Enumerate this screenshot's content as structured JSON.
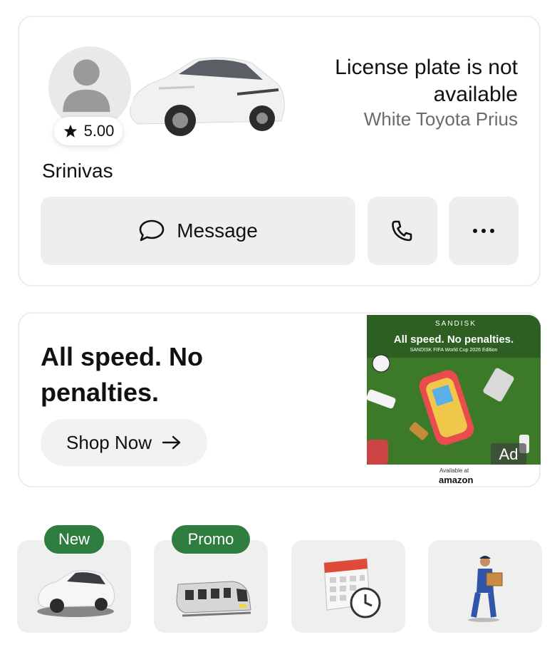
{
  "driver": {
    "name": "Srinivas",
    "rating": "5.00",
    "plate_status": "License plate is not available",
    "car_description": "White Toyota Prius"
  },
  "actions": {
    "message_label": "Message",
    "call_icon": "phone-icon",
    "more_icon": "more-horizontal-icon"
  },
  "ad": {
    "headline": "All speed. No penalties.",
    "cta_label": "Shop Now",
    "image_brand": "SANDISK",
    "image_title": "All speed. No penalties.",
    "image_subtitle": "SANDISK FIFA World Cup 2026 Edition",
    "ad_label": "Ad",
    "available_label": "Available at",
    "retailer": "amazon"
  },
  "services": {
    "tiles": [
      {
        "icon": "car-icon",
        "tag": "New"
      },
      {
        "icon": "train-icon",
        "tag": "Promo"
      },
      {
        "icon": "calendar-clock-icon",
        "tag": ""
      },
      {
        "icon": "courier-icon",
        "tag": ""
      }
    ]
  },
  "colors": {
    "tag_green": "#2e7d3e",
    "button_gray": "#eeeeee",
    "muted_text": "#6b6b6b"
  }
}
